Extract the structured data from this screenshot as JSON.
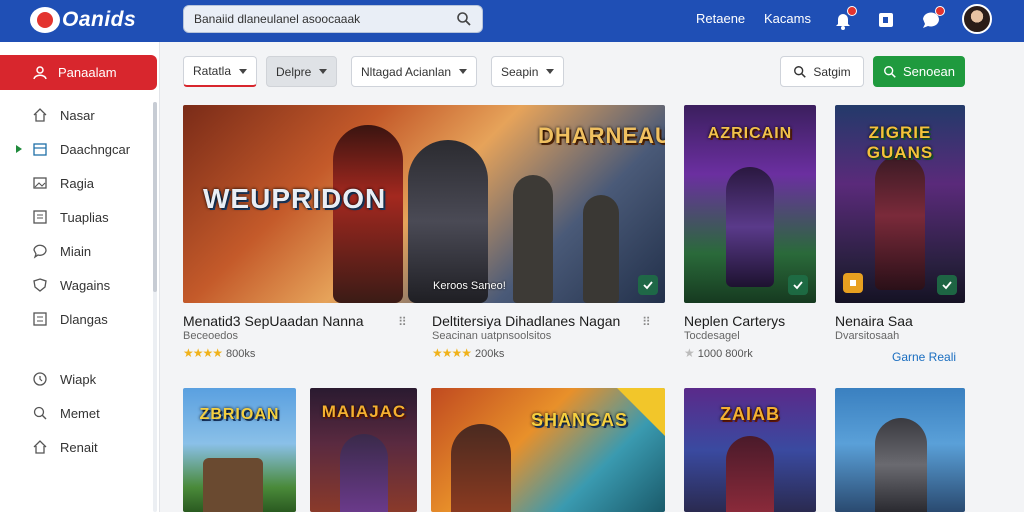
{
  "header": {
    "logo_text": "Oanids",
    "search_value": "Banaiid dlaneulanel asoocaaak",
    "links": [
      "Retaene",
      "Kacams"
    ],
    "accent": "#1f4fb5"
  },
  "sidebar": {
    "active": {
      "label": "Panaalam",
      "icon": "users-icon"
    },
    "items": [
      {
        "label": "Nasar",
        "icon": "home-icon"
      },
      {
        "label": "Daachngcar",
        "icon": "calendar-icon"
      },
      {
        "label": "Ragia",
        "icon": "gallery-icon"
      },
      {
        "label": "Tuaplias",
        "icon": "grid-icon"
      },
      {
        "label": "Miain",
        "icon": "chat-icon"
      },
      {
        "label": "Wagains",
        "icon": "shield-icon"
      },
      {
        "label": "Dlangas",
        "icon": "list-icon"
      },
      {
        "label": "Wiapk",
        "icon": "clock-icon"
      },
      {
        "label": "Memet",
        "icon": "search-icon"
      },
      {
        "label": "Renait",
        "icon": "home-icon"
      }
    ]
  },
  "filters": {
    "items": [
      "Ratatla",
      "Delpre",
      "Nltagad Acianlan",
      "Seapin"
    ],
    "search_button": "Satgim",
    "primary_button": "Senoean"
  },
  "cards": [
    {
      "art_title": "WEUPRIDON",
      "overlay": "Keroos Saneo!",
      "title": "Menatid3 SepUaadan Nanna",
      "sub": "Beceoedos",
      "stars": "★★★★",
      "rating": "800ks"
    },
    {
      "art_title": "DHARNEAU",
      "title": "Deltitersiya Dihadlanes Nagan",
      "sub": "Seacinan uatpnsoolsitos",
      "stars": "★★★★",
      "rating": "200ks"
    },
    {
      "art_title": "AZRICAIN",
      "title": "Neplen Carterys",
      "sub": "Tocdesagel",
      "stars": "★",
      "rating": "1000  800rk"
    },
    {
      "art_title": "ZIGRIE GUANS",
      "title": "Nenaira Saa",
      "sub": "Dvarsitosaah",
      "link": "Garne Reali"
    }
  ],
  "row2": [
    {
      "art_title": "ZBRIOAN"
    },
    {
      "art_title": "MAIAJAC"
    },
    {
      "art_title": "SHANGAS"
    },
    {
      "art_title": "ZAIAB"
    },
    {
      "art_title": ""
    }
  ],
  "colors": {
    "brand": "#1f4fb5",
    "active": "#d8262d",
    "primary": "#1f9a3e",
    "stars": "#f0b21b"
  }
}
